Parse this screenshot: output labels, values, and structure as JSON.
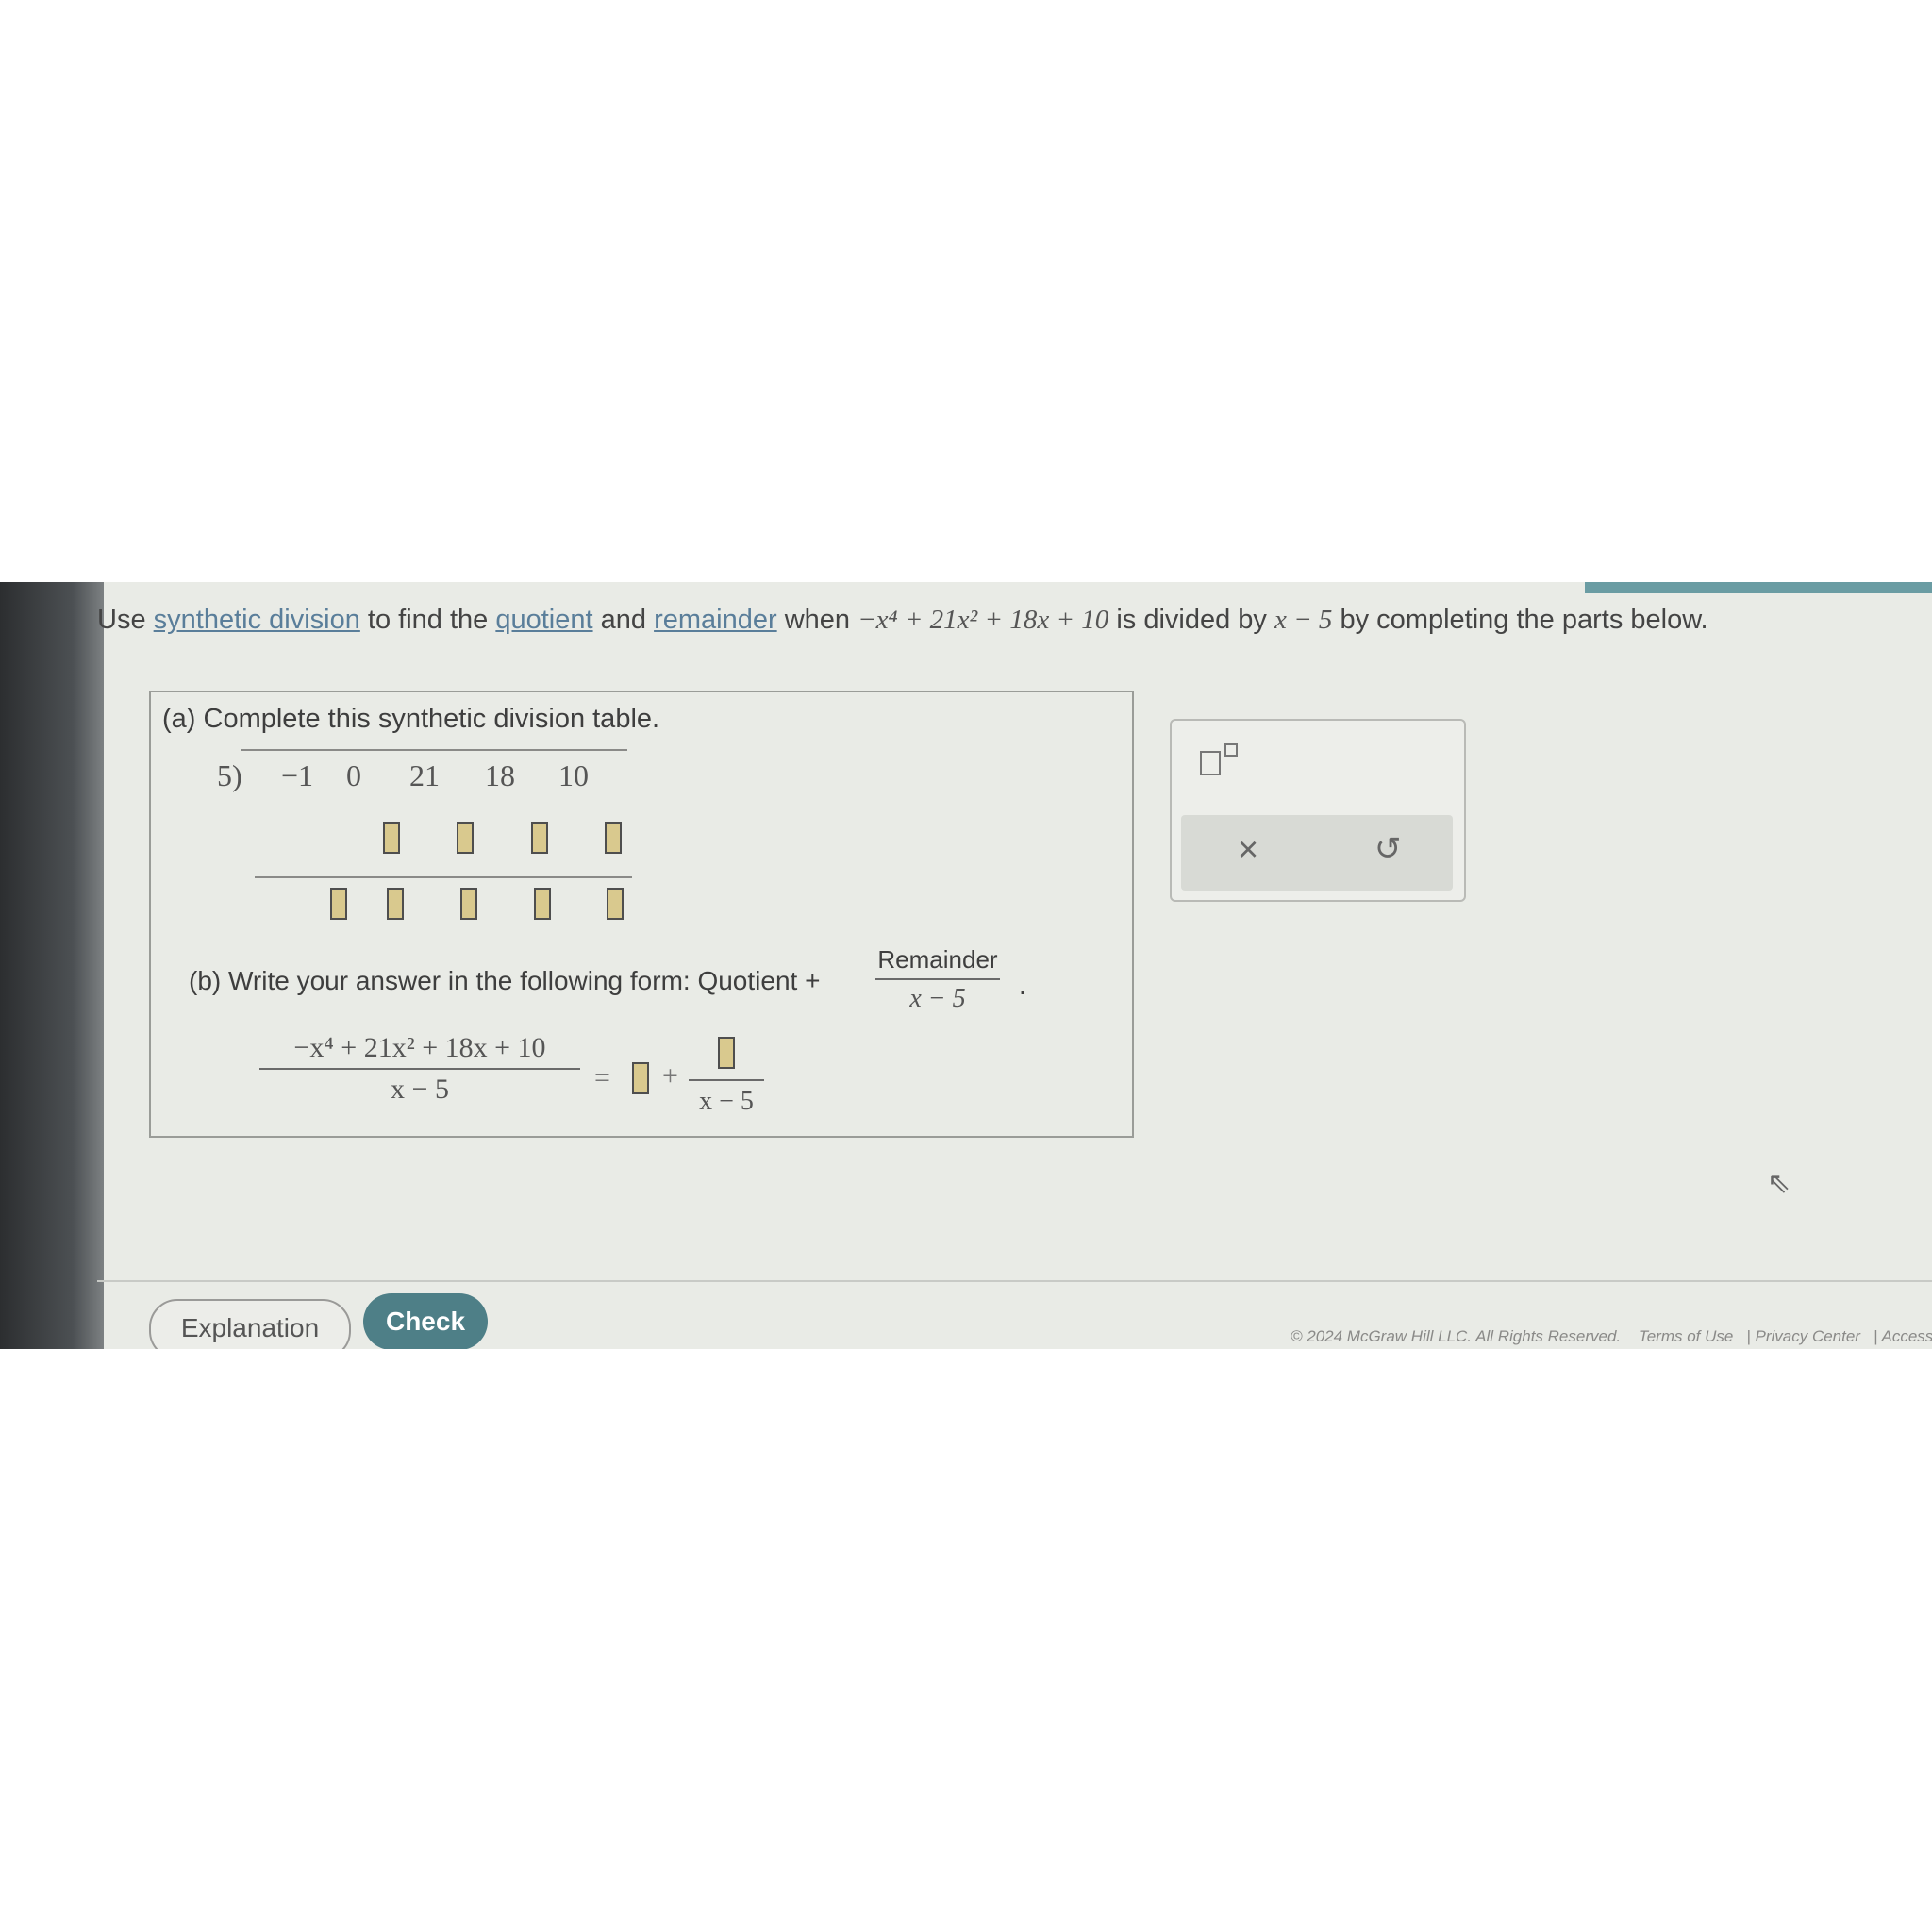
{
  "question": {
    "prefix": "Use",
    "link1": "synthetic division",
    "mid1": "to find the",
    "link2": "quotient",
    "mid2": "and",
    "link3": "remainder",
    "mid3": "when",
    "polynomial": "−x⁴ + 21x² + 18x + 10",
    "mid4": "is divided by",
    "divisor": "x − 5",
    "suffix": "by completing the parts below."
  },
  "part_a": {
    "title": "(a) Complete this synthetic division table.",
    "divisor": "5)",
    "coefficients": [
      "−1",
      "0",
      "21",
      "18",
      "10"
    ]
  },
  "part_b": {
    "label": "(b) Write your answer in the following form: Quotient +",
    "frac_num": "Remainder",
    "frac_den": "x − 5",
    "period": ".",
    "eq_num": "−x⁴ + 21x² + 18x + 10",
    "eq_den": "x − 5",
    "equals": "=",
    "plus": "+",
    "rem_den": "x − 5"
  },
  "tools": {
    "clear": "×",
    "undo": "↺"
  },
  "footer": {
    "explanation": "Explanation",
    "check": "Check",
    "copyright": "© 2024 McGraw Hill LLC. All Rights Reserved.",
    "terms": "Terms of Use",
    "privacy": "Privacy Center",
    "access": "Access"
  }
}
